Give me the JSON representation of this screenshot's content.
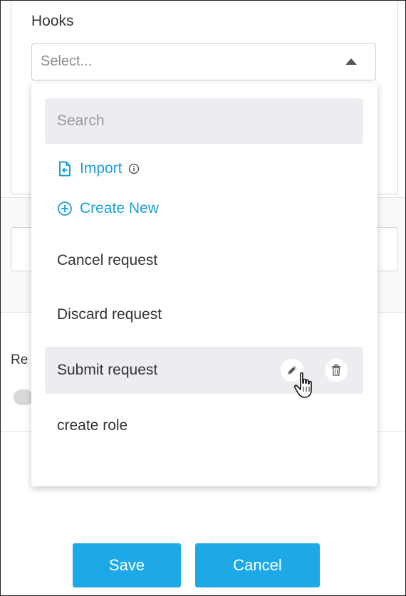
{
  "hooks": {
    "label": "Hooks",
    "select_placeholder": "Select...",
    "search_placeholder": "Search",
    "import_label": "Import",
    "create_new_label": "Create New",
    "options": [
      {
        "label": "Cancel request"
      },
      {
        "label": "Discard request"
      },
      {
        "label": "Submit request"
      },
      {
        "label": "create role"
      }
    ]
  },
  "background": {
    "partial_label": "Re"
  },
  "footer": {
    "save_label": "Save",
    "cancel_label": "Cancel"
  },
  "icons": {
    "import": "file-import-icon",
    "info": "info-icon",
    "create": "plus-circle-icon",
    "edit": "pencil-icon",
    "delete": "trash-icon",
    "dropdown_arrow": "caret-up-icon",
    "cursor": "hand-pointer-icon"
  },
  "colors": {
    "accent": "#1a9fd9",
    "button": "#1da9e6",
    "highlight": "#ebedf0"
  }
}
